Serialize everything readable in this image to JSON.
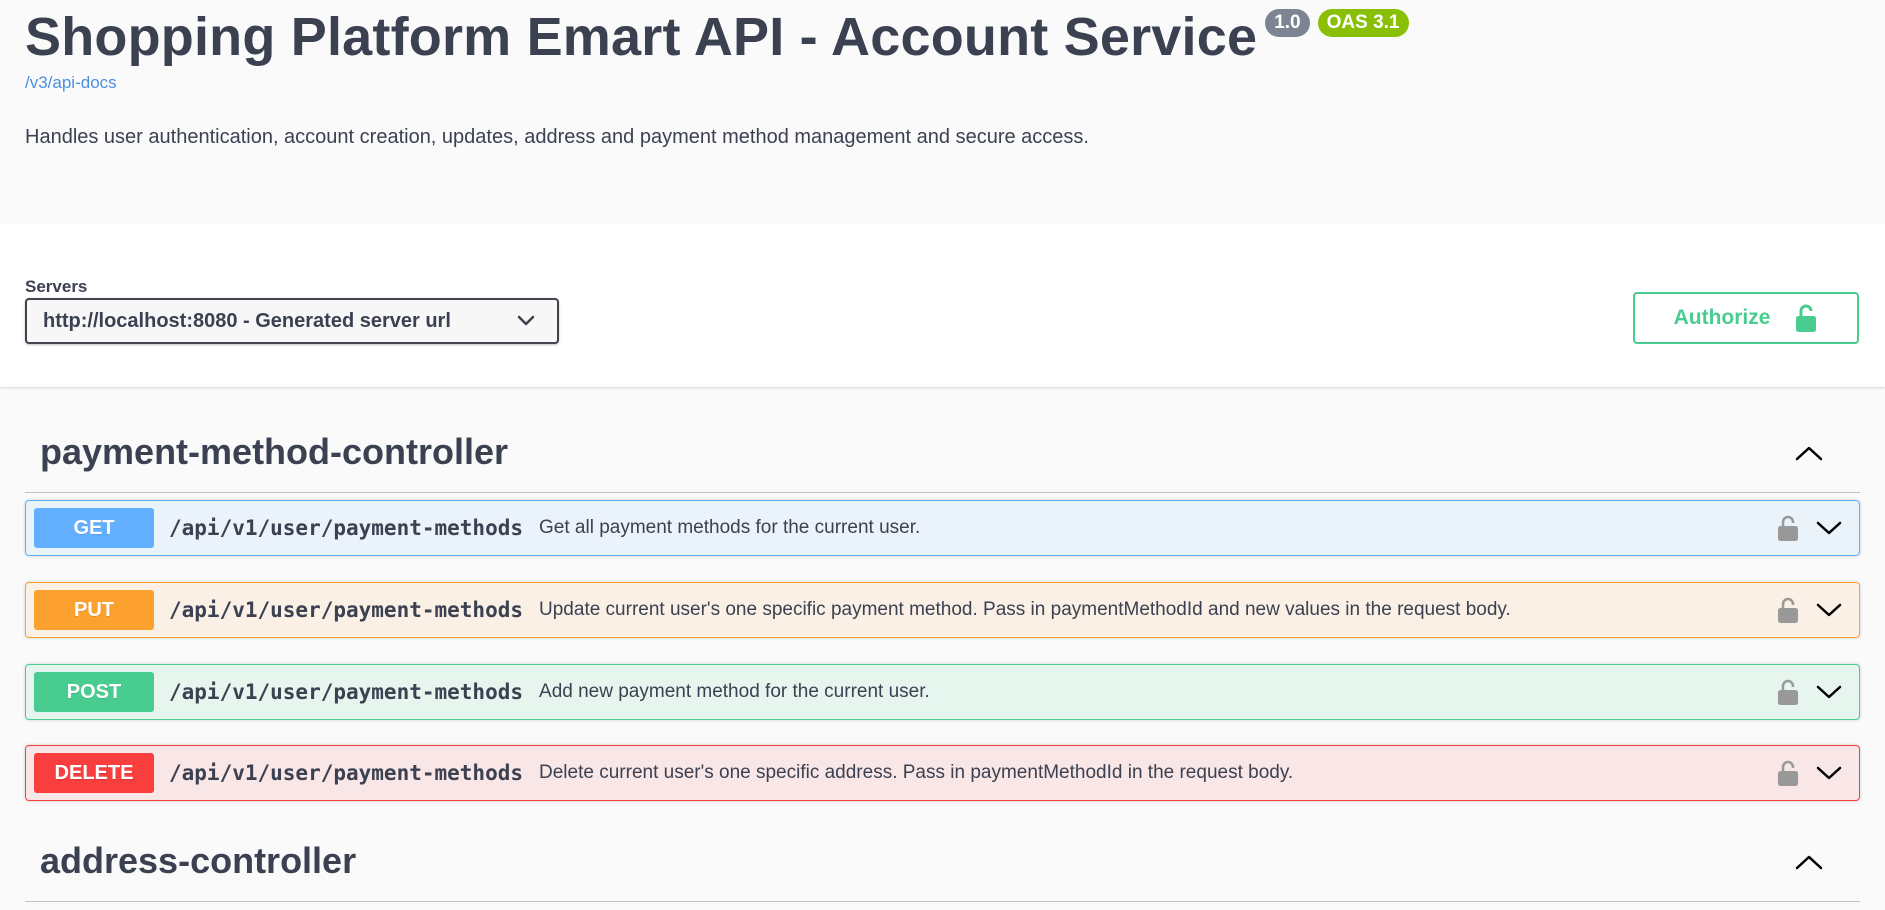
{
  "info": {
    "title": "Shopping Platform Emart API - Account Service",
    "version_badge": "1.0",
    "oas_badge": "OAS 3.1",
    "api_docs_link": "/v3/api-docs",
    "description": "Handles user authentication, account creation, updates, address and payment method management and secure access."
  },
  "servers": {
    "label": "Servers",
    "selected": "http://localhost:8080 - Generated server url"
  },
  "authorize": {
    "label": "Authorize"
  },
  "tags": [
    {
      "name": "payment-method-controller",
      "operations": [
        {
          "method": "GET",
          "path": "/api/v1/user/payment-methods",
          "summary": "Get all payment methods for the current user."
        },
        {
          "method": "PUT",
          "path": "/api/v1/user/payment-methods",
          "summary": "Update current user's one specific payment method. Pass in paymentMethodId and new values in the request body."
        },
        {
          "method": "POST",
          "path": "/api/v1/user/payment-methods",
          "summary": "Add new payment method for the current user."
        },
        {
          "method": "DELETE",
          "path": "/api/v1/user/payment-methods",
          "summary": "Delete current user's one specific address. Pass in paymentMethodId in the request body."
        }
      ]
    },
    {
      "name": "address-controller",
      "operations": []
    }
  ],
  "colors": {
    "get": "#61affe",
    "put": "#fca130",
    "post": "#49cc90",
    "delete": "#f93e3e",
    "link": "#4990e2",
    "version_badge": "#7d8492",
    "oas_badge": "#89bf04"
  },
  "icons": [
    "chevron-down-icon",
    "unlock-icon",
    "chevron-up-icon"
  ]
}
